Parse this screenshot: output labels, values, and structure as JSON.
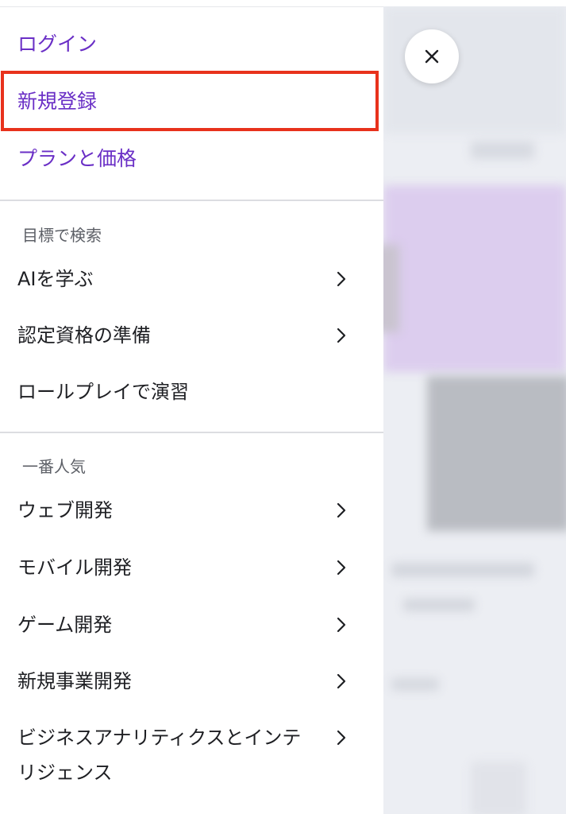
{
  "auth": {
    "login": "ログイン",
    "signup": "新規登録",
    "plans": "プランと価格"
  },
  "goals": {
    "heading": "目標で検索",
    "items": [
      {
        "label": "AIを学ぶ",
        "has_submenu": true
      },
      {
        "label": "認定資格の準備",
        "has_submenu": true
      },
      {
        "label": "ロールプレイで演習",
        "has_submenu": false
      }
    ]
  },
  "popular": {
    "heading": "一番人気",
    "items": [
      {
        "label": "ウェブ開発",
        "has_submenu": true
      },
      {
        "label": "モバイル開発",
        "has_submenu": true
      },
      {
        "label": "ゲーム開発",
        "has_submenu": true
      },
      {
        "label": "新規事業開発",
        "has_submenu": true
      },
      {
        "label": "ビジネスアナリティクスとインテリジェンス",
        "has_submenu": true
      }
    ]
  },
  "colors": {
    "accent": "#6a2fc6",
    "highlight": "#e8321c"
  },
  "icons": {
    "close": "close-icon",
    "chevron": "chevron-right-icon"
  }
}
